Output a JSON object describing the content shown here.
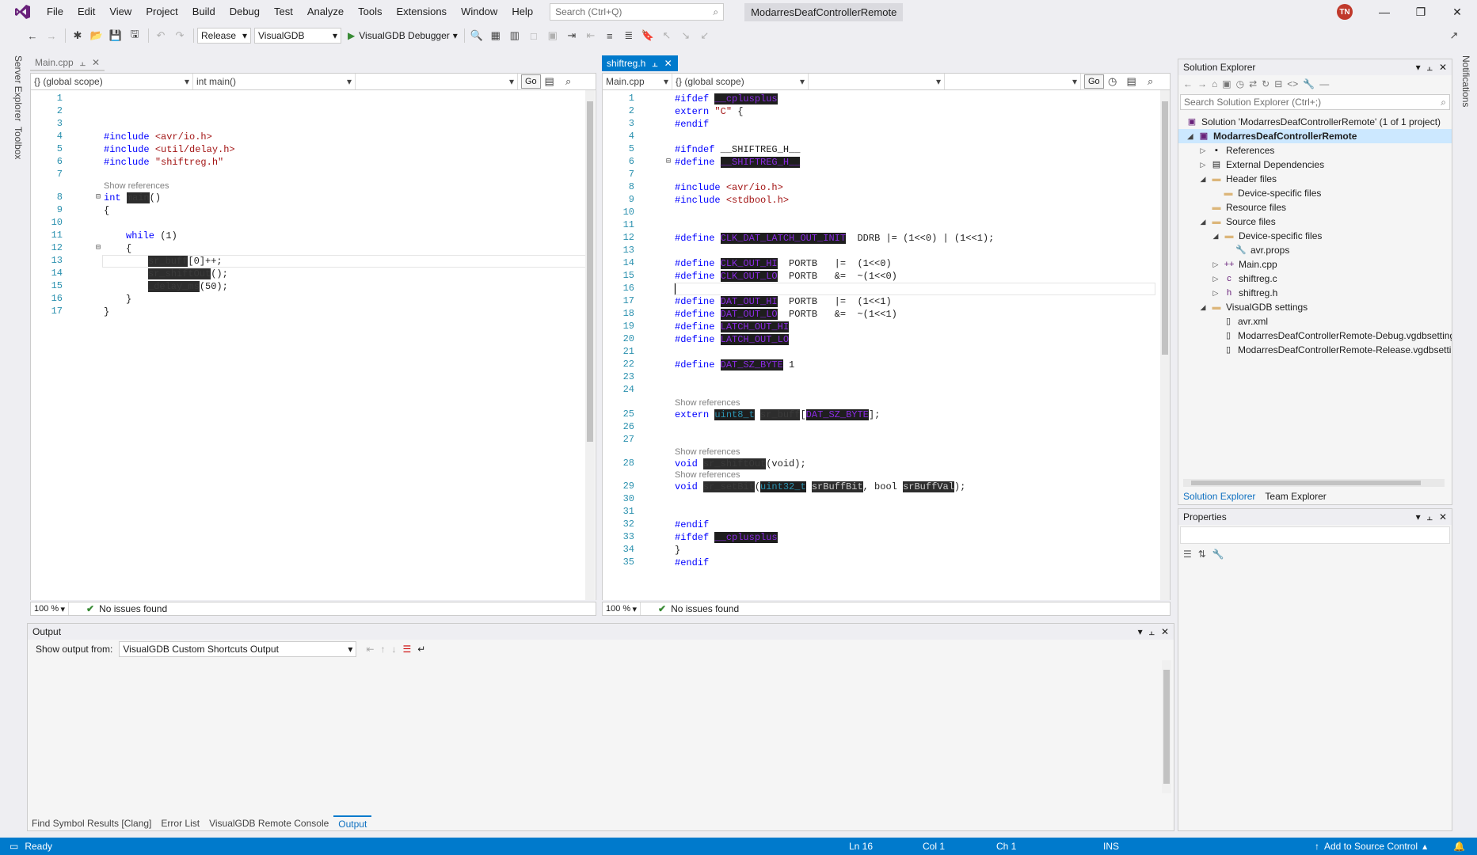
{
  "menu": [
    "File",
    "Edit",
    "View",
    "Project",
    "Build",
    "Debug",
    "Test",
    "Analyze",
    "Tools",
    "Extensions",
    "Window",
    "Help"
  ],
  "search_placeholder": "Search (Ctrl+Q)",
  "app_title": "ModarresDeafControllerRemote",
  "avatar_initials": "TN",
  "toolbar": {
    "configuration": "Release",
    "platform": "VisualGDB",
    "debugger": "VisualGDB Debugger"
  },
  "left_strip": {
    "server_explorer": "Server Explorer",
    "toolbox": "Toolbox"
  },
  "right_strip": {
    "notifications": "Notifications"
  },
  "left_editor": {
    "tab": "Main.cpp",
    "scope": "{} (global scope)",
    "member": "int main()",
    "go": "Go",
    "zoom": "100 %",
    "issues": "No issues found",
    "line_numbers": [
      "1",
      "2",
      "3",
      "4",
      "5",
      "6",
      "7",
      "8",
      "9",
      "10",
      "11",
      "12",
      "13",
      "14",
      "15",
      "16",
      "17"
    ],
    "code": {
      "l4_kw": "#include",
      "l4_str": "<avr/io.h>",
      "l5_kw": "#include",
      "l5_str": "<util/delay.h>",
      "l6_kw": "#include",
      "l6_str": "\"shiftreg.h\"",
      "l8_kw": "int",
      "l8_fn": "main",
      "l8_rest": "()",
      "l9": "{",
      "l11_kw": "while",
      "l11_rest": " (1)",
      "l12": "{",
      "l13_id": "sr_buff",
      "l13_rest": "[0]++;",
      "l14_id": "sr_shiftOut",
      "l14_rest": "();",
      "l15_id": "_delay_ms",
      "l15_rest": "(50);",
      "l16": "}",
      "l17": "}"
    },
    "show_references": "Show references"
  },
  "right_editor": {
    "tab": "shiftreg.h",
    "file_combo": "Main.cpp",
    "scope": "{} (global scope)",
    "go": "Go",
    "zoom": "100 %",
    "issues": "No issues found",
    "line_numbers": [
      "1",
      "2",
      "3",
      "4",
      "5",
      "6",
      "7",
      "8",
      "9",
      "10",
      "11",
      "12",
      "13",
      "14",
      "15",
      "16",
      "17",
      "18",
      "19",
      "20",
      "21",
      "22",
      "23",
      "24",
      "25",
      "26",
      "27",
      "28",
      "29",
      "30",
      "31",
      "32",
      "33",
      "34",
      "35"
    ],
    "show_references": "Show references",
    "code": {
      "l1_kw": "#ifdef",
      "l1_id": "__cplusplus",
      "l2_kw": "extern",
      "l2_str": "\"C\"",
      "l2_rest": " {",
      "l3_kw": "#endif",
      "l5_kw": "#ifndef",
      "l5_rest": " __SHIFTREG_H__",
      "l6_kw": "#define",
      "l6_id": "__SHIFTREG_H__",
      "l8_kw": "#include",
      "l8_str": "<avr/io.h>",
      "l9_kw": "#include",
      "l9_str": "<stdbool.h>",
      "l12_kw": "#define",
      "l12_id": "CLK_DAT_LATCH_OUT_INIT",
      "l12_rest": "  DDRB |= (1<<0) | (1<<1);",
      "l14_kw": "#define",
      "l14_id": "CLK_OUT_HI",
      "l14_rest": "  PORTB   |=  (1<<0)",
      "l15_kw": "#define",
      "l15_id": "CLK_OUT_LO",
      "l15_rest": "  PORTB   &=  ~(1<<0)",
      "l17_kw": "#define",
      "l17_id": "DAT_OUT_HI",
      "l17_rest": "  PORTB   |=  (1<<1)",
      "l18_kw": "#define",
      "l18_id": "DAT_OUT_LO",
      "l18_rest": "  PORTB   &=  ~(1<<1)",
      "l19_kw": "#define",
      "l19_id": "LATCH_OUT_HI",
      "l20_kw": "#define",
      "l20_id": "LATCH_OUT_LO",
      "l22_kw": "#define",
      "l22_id": "DAT_SZ_BYTE",
      "l22_rest": " 1",
      "l25_kw": "extern",
      "l25_t": "uint8_t",
      "l25_id": "sr_buff",
      "l25_b1": "[",
      "l25_id2": "DAT_SZ_BYTE",
      "l25_b2": "];",
      "l28_kw": "void",
      "l28_id": "sr_shiftOut",
      "l28_rest": "(void);",
      "l29_kw": "void",
      "l29_id": "sr_setBit",
      "l29_p": "(",
      "l29_t": "uint32_t",
      "l29_a": "srBuffBit",
      "l29_c": ", bool ",
      "l29_b": "srBuffVal",
      "l29_e": ");",
      "l32_kw": "#endif",
      "l33_kw": "#ifdef",
      "l33_id": "__cplusplus",
      "l34": "}",
      "l35_kw": "#endif"
    }
  },
  "solution_explorer": {
    "title": "Solution Explorer",
    "search": "Search Solution Explorer (Ctrl+;)",
    "items": [
      {
        "label": "Solution 'ModarresDeafControllerRemote' (1 of 1 project)"
      },
      {
        "label": "ModarresDeafControllerRemote"
      },
      {
        "label": "References"
      },
      {
        "label": "External Dependencies"
      },
      {
        "label": "Header files"
      },
      {
        "label": "Device-specific files"
      },
      {
        "label": "Resource files"
      },
      {
        "label": "Source files"
      },
      {
        "label": "Device-specific files"
      },
      {
        "label": "avr.props"
      },
      {
        "label": "Main.cpp"
      },
      {
        "label": "shiftreg.c"
      },
      {
        "label": "shiftreg.h"
      },
      {
        "label": "VisualGDB settings"
      },
      {
        "label": "avr.xml"
      },
      {
        "label": "ModarresDeafControllerRemote-Debug.vgdbsettings"
      },
      {
        "label": "ModarresDeafControllerRemote-Release.vgdbsettings"
      }
    ],
    "tabs": [
      "Solution Explorer",
      "Team Explorer"
    ]
  },
  "properties": {
    "title": "Properties"
  },
  "output": {
    "title": "Output",
    "show_from_label": "Show output from:",
    "source": "VisualGDB Custom Shortcuts Output"
  },
  "bottom_tabs": [
    "Find Symbol Results [Clang]",
    "Error List",
    "VisualGDB Remote Console",
    "Output"
  ],
  "statusbar": {
    "ready": "Ready",
    "ln": "Ln 16",
    "col": "Col 1",
    "ch": "Ch 1",
    "ins": "INS",
    "source_control": "Add to Source Control"
  },
  "colors": {
    "accent": "#007acc",
    "vs_purple": "#68217a",
    "keyword": "#0000ff",
    "string": "#a31515",
    "line_number": "#2b91af"
  }
}
